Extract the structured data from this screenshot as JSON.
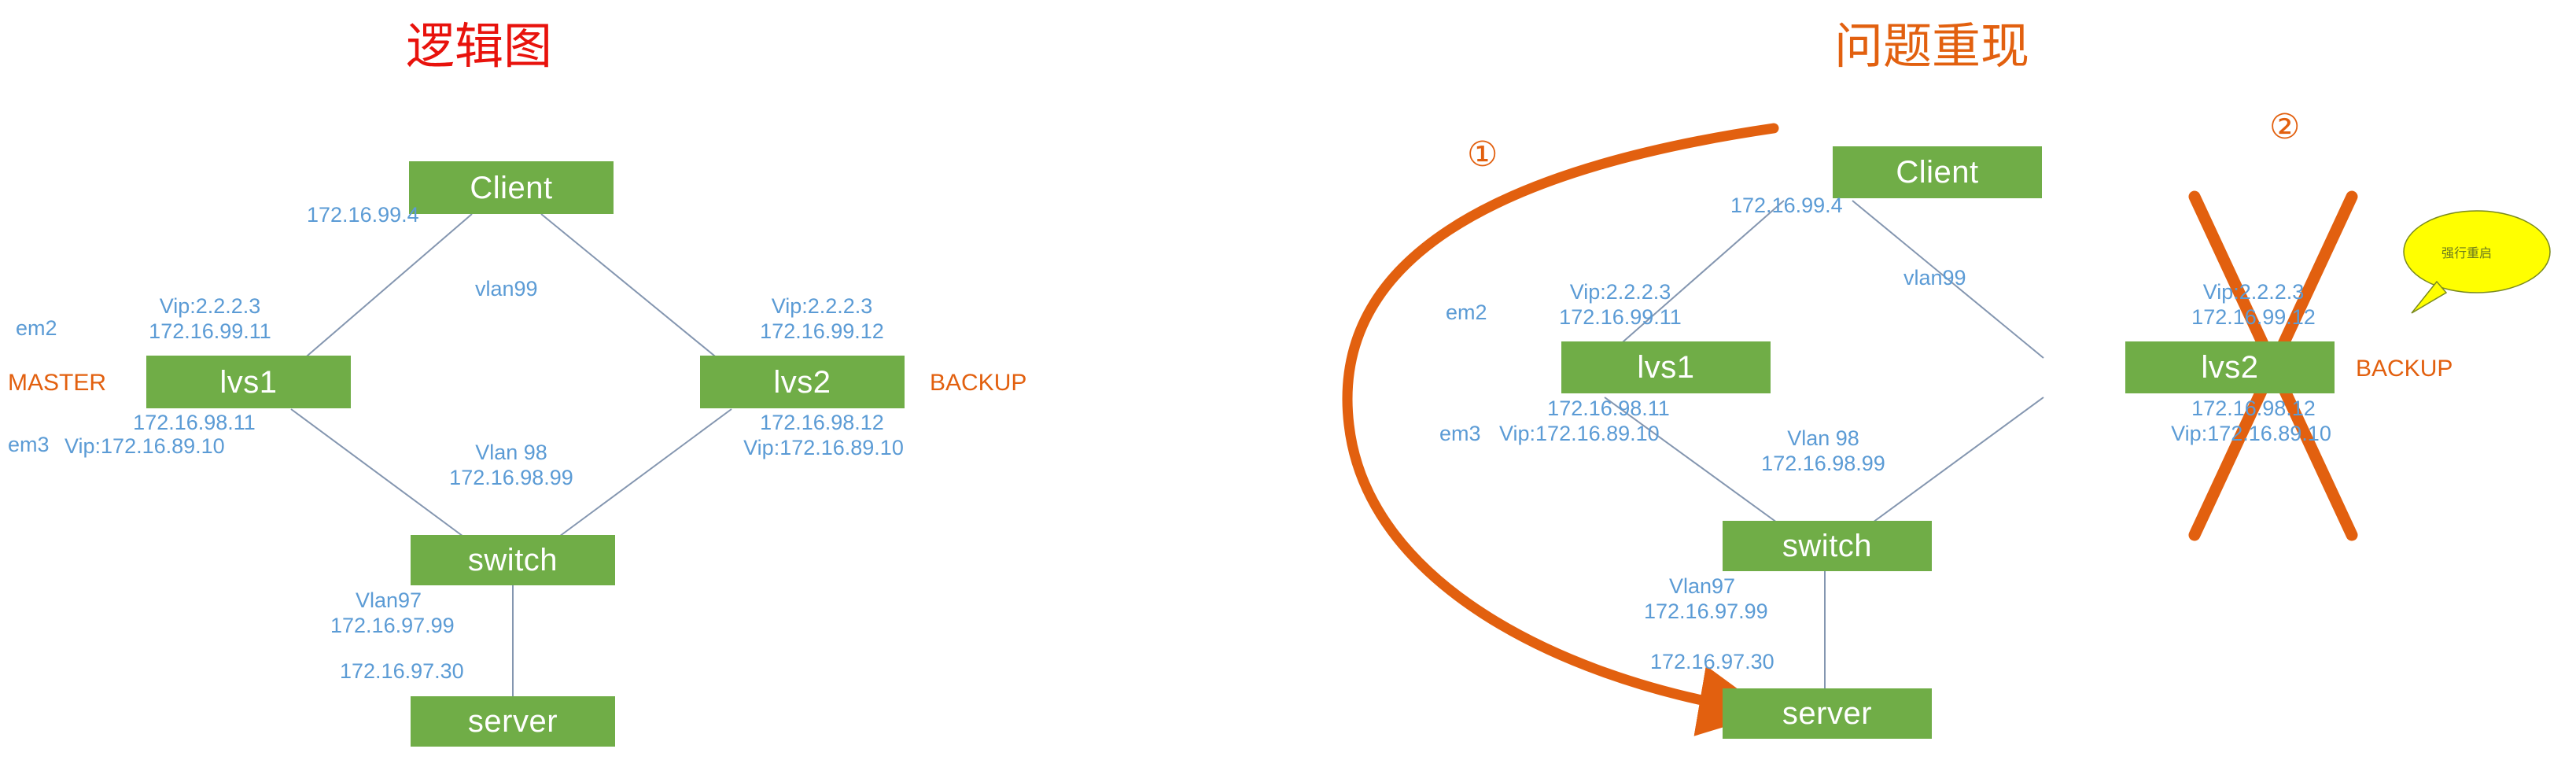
{
  "panels": {
    "left": {
      "title": "逻辑图",
      "title_color": "#e8120c",
      "nodes": {
        "client": "Client",
        "lvs1": "lvs1",
        "lvs2": "lvs2",
        "switch": "switch",
        "server": "server"
      },
      "roles": {
        "master": "MASTER",
        "backup": "BACKUP"
      },
      "labels": {
        "client_ip": "172.16.99.4",
        "vlan99": "vlan99",
        "lvs1_nic_top": "em2",
        "lvs1_vip_top": "Vip:2.2.2.3",
        "lvs1_ip_top": "172.16.99.11",
        "lvs1_nic_bottom": "em3",
        "lvs1_ip_bottom": "172.16.98.11",
        "lvs1_vip_bottom": "Vip:172.16.89.10",
        "lvs2_vip_top": "Vip:2.2.2.3",
        "lvs2_ip_top": "172.16.99.12",
        "lvs2_ip_bottom": "172.16.98.12",
        "lvs2_vip_bottom": "Vip:172.16.89.10",
        "vlan98": "Vlan 98",
        "vlan98_ip": "172.16.98.99",
        "vlan97": "Vlan97",
        "vlan97_ip": "172.16.97.99",
        "server_ip": "172.16.97.30"
      }
    },
    "right": {
      "title": "问题重现",
      "title_color": "#e2600f",
      "nodes": {
        "client": "Client",
        "lvs1": "lvs1",
        "lvs2": "lvs2",
        "switch": "switch",
        "server": "server"
      },
      "roles": {
        "backup": "BACKUP"
      },
      "markers": {
        "step1": "①",
        "step2": "②"
      },
      "callout": {
        "text": "强行重启",
        "fill": "#ffff00",
        "text_color": "#6b7a1e"
      },
      "labels": {
        "client_ip": "172.16.99.4",
        "vlan99": "vlan99",
        "lvs1_nic_top": "em2",
        "lvs1_vip_top": "Vip:2.2.2.3",
        "lvs1_ip_top": "172.16.99.11",
        "lvs1_nic_bottom": "em3",
        "lvs1_ip_bottom": "172.16.98.11",
        "lvs1_vip_bottom": "Vip:172.16.89.10",
        "lvs2_vip_top": "Vip:2.2.2.3",
        "lvs2_ip_top": "172.16.99.12",
        "lvs2_ip_bottom": "172.16.98.12",
        "lvs2_vip_bottom": "Vip:172.16.89.10",
        "vlan98": "Vlan 98",
        "vlan98_ip": "172.16.98.99",
        "vlan97": "Vlan97",
        "vlan97_ip": "172.16.97.99",
        "server_ip": "172.16.97.30"
      }
    }
  },
  "colors": {
    "node_fill": "#70ad47",
    "node_text": "#ffffff",
    "ip_text": "#5b9bd5",
    "accent_orange": "#e2600f",
    "title_red": "#e8120c",
    "connector": "#8496b0",
    "callout_yellow": "#ffff00"
  }
}
